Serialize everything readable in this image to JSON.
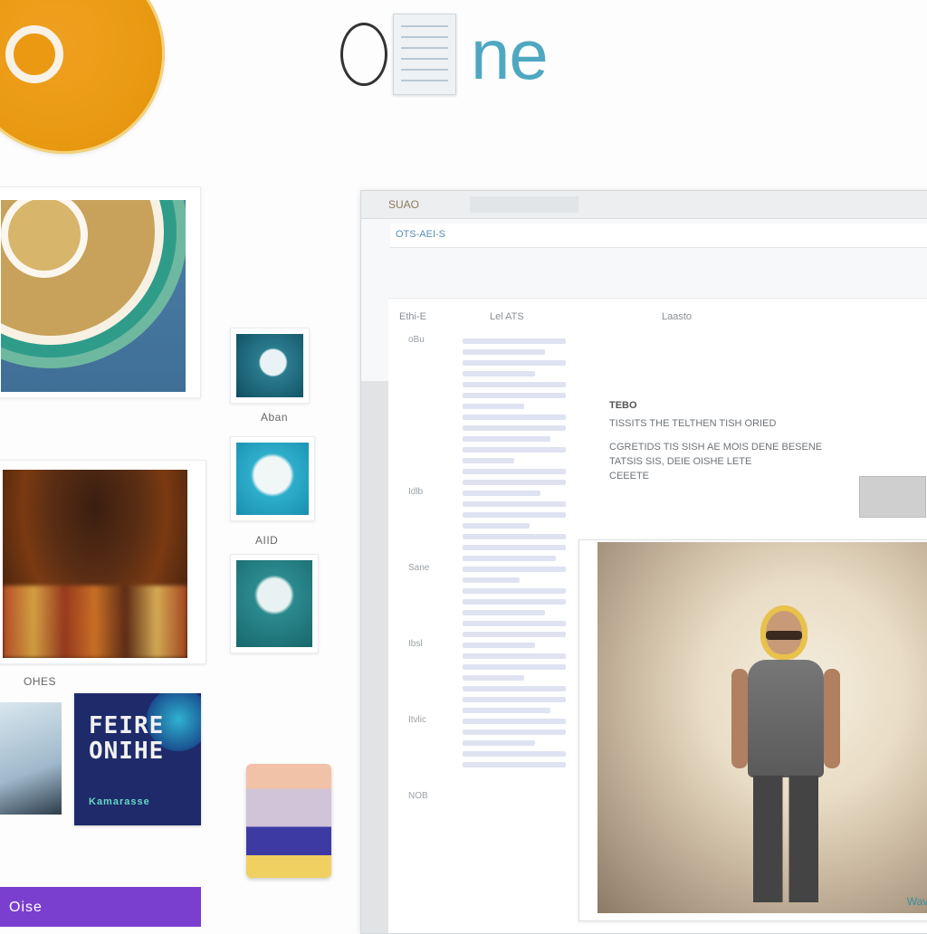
{
  "brand": {
    "wordmark_suffix": "ne"
  },
  "colors": {
    "accent": "#4ea8c2",
    "logo": "#e99a12",
    "purple": "#7b3fd0",
    "poster": "#1e2a6a"
  },
  "gallery": {
    "caption_1": "Aban",
    "caption_2": "AIID",
    "caption_3": "OHES",
    "poster_title": "FEIRE\nONIHE",
    "poster_subtitle": "Kamarasse",
    "purple_label": "Oise"
  },
  "window": {
    "title": "SUAO",
    "address": "OTS-AEI-S",
    "tabs": [
      "Ethi-E",
      "Lel ATS",
      "Laasto"
    ],
    "side_labels": [
      "oBu",
      "",
      "Idlb",
      "Sane",
      "Ibsl",
      "Itvlic",
      "NOB"
    ],
    "article_heading": "TEBO",
    "article_lines": [
      "TISSITS THE TELTHEN TISH ORIED",
      "CGRETIDS TIS SISH AE MOIS DENE BESENE",
      "TATSIS SIS, DEIE OISHE LETE",
      "CEEETE"
    ],
    "photo_caption": "Wave"
  },
  "icons": [
    "logo-icon",
    "document-icon"
  ]
}
